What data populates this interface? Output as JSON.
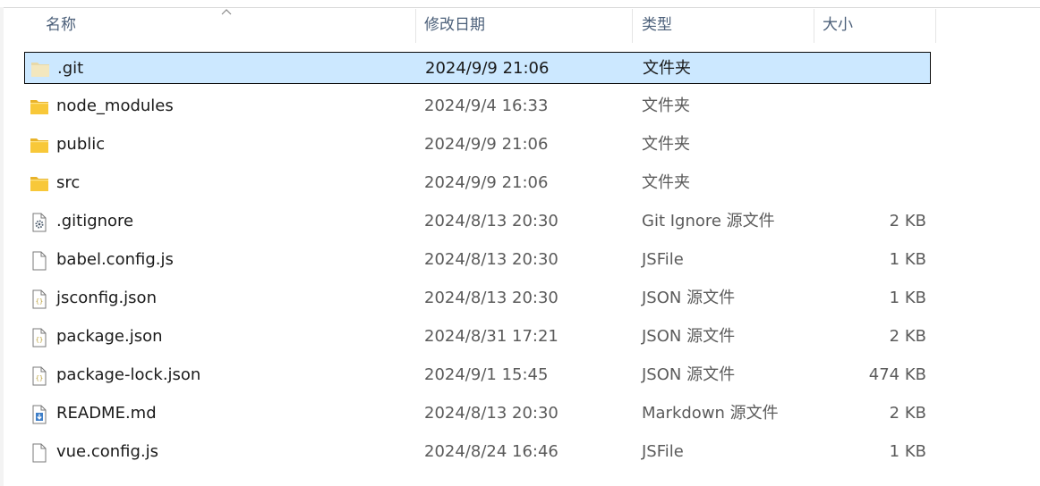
{
  "columns": {
    "name": "名称",
    "date": "修改日期",
    "type": "类型",
    "size": "大小"
  },
  "sort": {
    "column": "name",
    "direction": "ascending",
    "icon": "sort-up-icon"
  },
  "selected_index": 0,
  "files": [
    {
      "name": ".git",
      "date": "2024/9/9 21:06",
      "type": "文件夹",
      "size": "",
      "icon": "folder-icon"
    },
    {
      "name": "node_modules",
      "date": "2024/9/4 16:33",
      "type": "文件夹",
      "size": "",
      "icon": "folder-icon"
    },
    {
      "name": "public",
      "date": "2024/9/9 21:06",
      "type": "文件夹",
      "size": "",
      "icon": "folder-icon"
    },
    {
      "name": "src",
      "date": "2024/9/9 21:06",
      "type": "文件夹",
      "size": "",
      "icon": "folder-icon"
    },
    {
      "name": ".gitignore",
      "date": "2024/8/13 20:30",
      "type": "Git Ignore 源文件",
      "size": "2 KB",
      "icon": "config-file-icon"
    },
    {
      "name": "babel.config.js",
      "date": "2024/8/13 20:30",
      "type": "JSFile",
      "size": "1 KB",
      "icon": "blank-file-icon"
    },
    {
      "name": "jsconfig.json",
      "date": "2024/8/13 20:30",
      "type": "JSON 源文件",
      "size": "1 KB",
      "icon": "json-file-icon"
    },
    {
      "name": "package.json",
      "date": "2024/8/31 17:21",
      "type": "JSON 源文件",
      "size": "2 KB",
      "icon": "json-file-icon"
    },
    {
      "name": "package-lock.json",
      "date": "2024/9/1 15:45",
      "type": "JSON 源文件",
      "size": "474 KB",
      "icon": "json-file-icon"
    },
    {
      "name": "README.md",
      "date": "2024/8/13 20:30",
      "type": "Markdown 源文件",
      "size": "2 KB",
      "icon": "markdown-file-icon"
    },
    {
      "name": "vue.config.js",
      "date": "2024/8/24 16:46",
      "type": "JSFile",
      "size": "1 KB",
      "icon": "blank-file-icon"
    }
  ],
  "colors": {
    "selection": "#cce8ff",
    "header_text": "#4c607a",
    "folder": "#f8c839"
  }
}
